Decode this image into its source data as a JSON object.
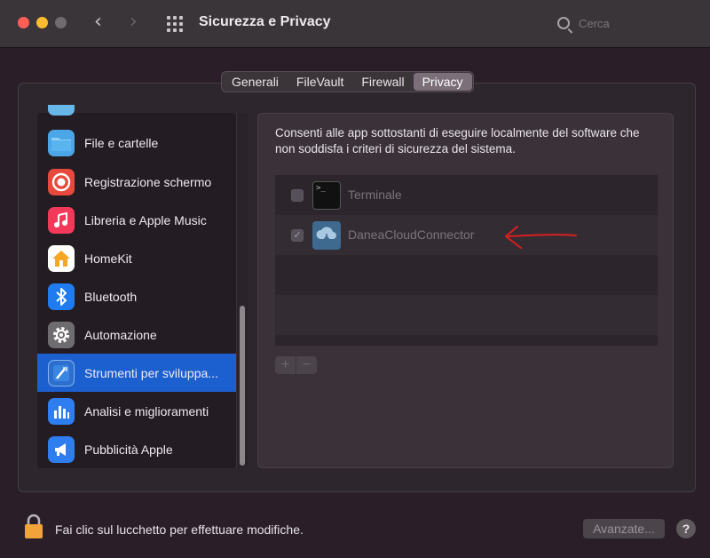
{
  "window": {
    "title": "Sicurezza e Privacy",
    "search_placeholder": "Cerca",
    "back_glyph": "‹",
    "forward_glyph": "›"
  },
  "tabs": [
    {
      "label": "Generali",
      "active": false
    },
    {
      "label": "FileVault",
      "active": false
    },
    {
      "label": "Firewall",
      "active": false
    },
    {
      "label": "Privacy",
      "active": true
    }
  ],
  "sidebar": {
    "items": [
      {
        "label": "File e cartelle",
        "icon": "folder-icon",
        "color": "#4aa6e6"
      },
      {
        "label": "Registrazione schermo",
        "icon": "screen-record-icon",
        "color": "#e7493c"
      },
      {
        "label": "Libreria e Apple Music",
        "icon": "music-note-icon",
        "color": "#f2395a"
      },
      {
        "label": "HomeKit",
        "icon": "home-icon",
        "color": "#f6a623"
      },
      {
        "label": "Bluetooth",
        "icon": "bluetooth-icon",
        "color": "#1f7cf0"
      },
      {
        "label": "Automazione",
        "icon": "gear-icon",
        "color": "#7d7a7e"
      },
      {
        "label": "Strumenti per sviluppa...",
        "icon": "developer-tools-icon",
        "color": "#2d6fcf",
        "selected": true
      },
      {
        "label": "Analisi e miglioramenti",
        "icon": "bar-chart-icon",
        "color": "#2f7ef0"
      },
      {
        "label": "Pubblicità Apple",
        "icon": "megaphone-icon",
        "color": "#2f7ef0"
      }
    ]
  },
  "content": {
    "description": "Consenti alle app sottostanti di eseguire localmente del software che non soddisfa i criteri di sicurezza del sistema.",
    "apps": [
      {
        "name": "Terminale",
        "icon": "terminal-icon",
        "checked": false,
        "icon_text": ">_"
      },
      {
        "name": "DaneaCloudConnector",
        "icon": "cloud-connector-icon",
        "checked": true
      }
    ],
    "add_label": "+",
    "remove_label": "−",
    "check_glyph": "✓"
  },
  "footer": {
    "lock_text": "Fai clic sul lucchetto per effettuare modifiche.",
    "advanced_label": "Avanzate...",
    "help_label": "?"
  },
  "colors": {
    "accent": "#1c5fcf",
    "annotation": "#d6201f"
  }
}
